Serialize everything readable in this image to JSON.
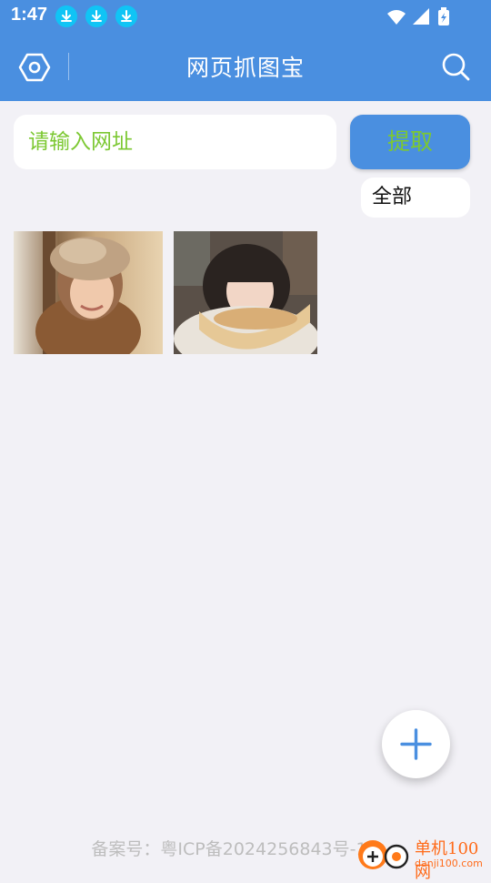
{
  "status_bar": {
    "time": "1:47",
    "colors": {
      "background": "#4a8fe0",
      "download_badge": "#10c4f5"
    },
    "icons": [
      "download-icon",
      "download-icon",
      "download-icon",
      "wifi-icon",
      "signal-icon",
      "battery-charging-icon"
    ]
  },
  "app_bar": {
    "title": "网页抓图宝",
    "colors": {
      "background": "#4a8fe0",
      "text": "#ffffff"
    },
    "icons": {
      "left": "settings-icon",
      "right": "search-icon"
    }
  },
  "search": {
    "placeholder": "请输入网址",
    "value": "",
    "extract_label": "提取"
  },
  "filter": {
    "selected": "全部"
  },
  "images": [
    {
      "alt": "photo-girl-fur-hat"
    },
    {
      "alt": "photo-girl-pillow"
    }
  ],
  "fab": {
    "icon": "plus-icon"
  },
  "footer": {
    "icp": "备案号：粤ICP备2024256843号-1"
  },
  "watermark": {
    "text": "单机100网",
    "sub": "danji100.com"
  },
  "colors": {
    "accent": "#4a8fe0",
    "text_green": "#7cc832",
    "page_bg": "#f2f1f6"
  }
}
